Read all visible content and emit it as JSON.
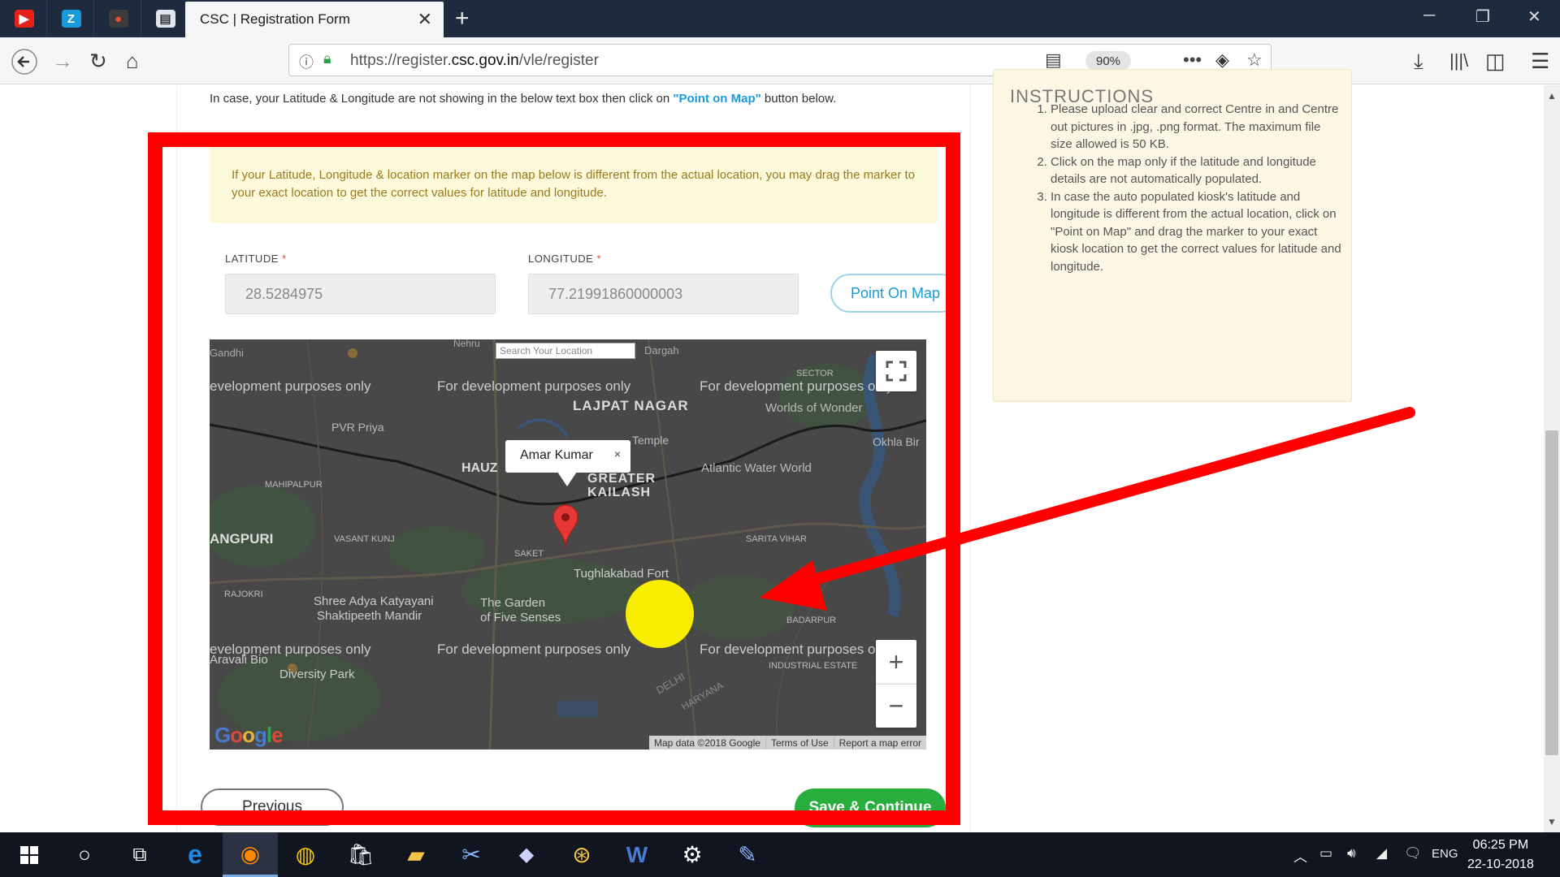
{
  "browser": {
    "active_tab_title": "CSC | Registration Form",
    "url_prefix": "https://register.",
    "url_domain": "csc.gov.in",
    "url_path": "/vle/register",
    "zoom": "90%"
  },
  "pinned_tabs": [
    {
      "icon": "youtube-icon",
      "glyph": "▶",
      "color": "#e62117"
    },
    {
      "icon": "z-app-icon",
      "glyph": "Z",
      "color": "#1a9bd7"
    },
    {
      "icon": "recorder-icon",
      "glyph": "●",
      "color": "#c0392b"
    },
    {
      "icon": "document-icon",
      "glyph": "▤",
      "color": "#dfe6ee"
    }
  ],
  "page": {
    "hint_prefix": "In case, your Latitude & Longitude are not showing in the below text box then click on ",
    "hint_link": "\"Point on Map\"",
    "hint_suffix": " button below.",
    "notice": "If your Latitude, Longitude & location marker on the map below is different from the actual location, you may drag the marker to your exact location to get the correct values for latitude and longitude.",
    "latitude_label": "LATITUDE",
    "longitude_label": "LONGITUDE",
    "required_mark": "*",
    "latitude_value": "28.5284975",
    "longitude_value": "77.21991860000003",
    "point_on_map_label": "Point On Map",
    "previous_label": "Previous",
    "save_continue_label": "Save & Continue"
  },
  "map": {
    "search_placeholder": "Search Your Location",
    "infowindow_text": "Amar Kumar",
    "infowindow_close": "×",
    "watermark": "For development purposes only",
    "watermark_partial": "evelopment purposes only",
    "place_labels": {
      "lajpat_nagar": "LAJPAT NAGAR",
      "greater_kailash": "GREATER KAILASH",
      "hauz": "HAUZ",
      "angpuri": "ANGPURI",
      "pvr_priya": "PVR Priya",
      "worlds_of_wonder": "Worlds of Wonder",
      "atlantic_water_world": "Atlantic Water World",
      "okhla_bird": "Okhla Bir",
      "tughlakabad_fort": "Tughlakabad Fort",
      "garden_five_senses_1": "The Garden",
      "garden_five_senses_2": "of Five Senses",
      "shree_adya_1": "Shree Adya Katyayani",
      "shree_adya_2": "Shaktipeeth Mandir",
      "aravali_1": "Aravali Bio",
      "aravali_2": "Diversity Park",
      "mahipalpur": "MAHIPALPUR",
      "vasant_kunj": "VASANT KUNJ",
      "sarita_vihar": "SARITA VIHAR",
      "rajokri": "RAJOKRI",
      "badarpur": "BADARPUR",
      "industrial_estate": "INDUSTRIAL ESTATE",
      "sector": "SECTOR",
      "gandhi": "Gandhi",
      "dargah": "Dargah",
      "temple": "Temple",
      "saket": "SAKET",
      "delhi": "DELHI",
      "haryana": "HARYANA",
      "nehru": "Nehru"
    },
    "attribution": [
      "Map data ©2018 Google",
      "Terms of Use",
      "Report a map error"
    ],
    "google_logo": "Google",
    "zoom_in": "+",
    "zoom_out": "−",
    "fullscreen_glyph": "⛶"
  },
  "instructions": {
    "heading": "INSTRUCTIONS",
    "items": [
      "Please upload clear and correct Centre in and Centre out pictures in .jpg, .png format. The maximum file size allowed is 50 KB.",
      "Click on the map only if the latitude and longitude details are not automatically populated.",
      "In case the auto populated kiosk's latitude and longitude is different from the actual location, click on \"Point on Map\" and drag the marker to your exact kiosk location to get the correct values for latitude and longitude."
    ]
  },
  "taskbar": {
    "time": "06:25 PM",
    "date": "22-10-2018",
    "language": "ENG"
  },
  "colors": {
    "annotation_red": "#ff0000",
    "highlight_yellow": "#f8ec00",
    "link_blue": "#1a9bd7",
    "save_green": "#27ae3c"
  }
}
